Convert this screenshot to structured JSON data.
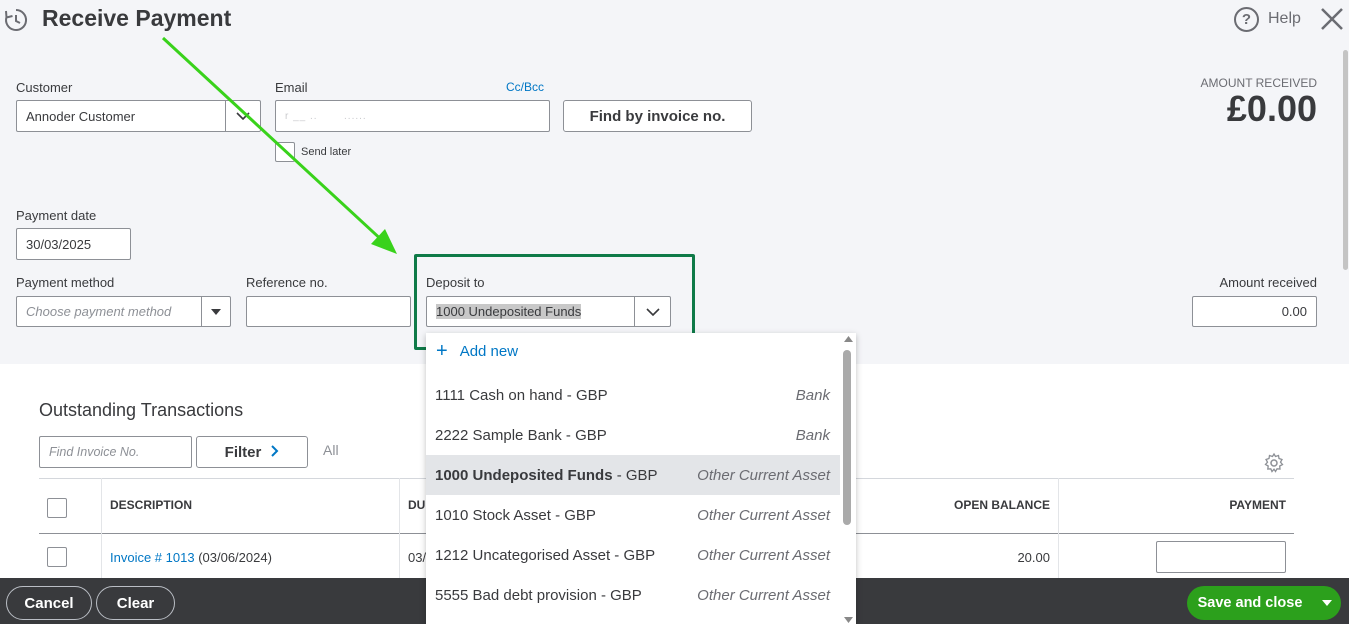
{
  "header": {
    "title": "Receive Payment",
    "help_label": "Help"
  },
  "customer": {
    "label": "Customer",
    "value": "Annoder Customer"
  },
  "email": {
    "label": "Email",
    "cc_bcc": "Cc/Bcc",
    "value": "r __ ..       ......",
    "send_later": "Send later"
  },
  "find_invoice_button": "Find by invoice no.",
  "amount_received_header": {
    "label": "AMOUNT RECEIVED",
    "value": "£0.00"
  },
  "payment_date": {
    "label": "Payment date",
    "value": "30/03/2025"
  },
  "payment_method": {
    "label": "Payment method",
    "placeholder": "Choose payment method"
  },
  "reference": {
    "label": "Reference no.",
    "value": ""
  },
  "deposit_to": {
    "label": "Deposit to",
    "value": "1000 Undeposited Funds"
  },
  "amount_received_field": {
    "label": "Amount received",
    "value": "0.00"
  },
  "deposit_dropdown": {
    "add_new": "Add new",
    "items": [
      {
        "name": "1111 Cash on hand",
        "currency": " - GBP",
        "type": "Bank",
        "selected": false
      },
      {
        "name": "2222 Sample Bank",
        "currency": " - GBP",
        "type": "Bank",
        "selected": false
      },
      {
        "name": "1000 Undeposited Funds",
        "currency": " - GBP",
        "type": "Other Current Asset",
        "selected": true
      },
      {
        "name": "1010 Stock Asset",
        "currency": " - GBP",
        "type": "Other Current Asset",
        "selected": false
      },
      {
        "name": "1212 Uncategorised Asset",
        "currency": " - GBP",
        "type": "Other Current Asset",
        "selected": false
      },
      {
        "name": "5555 Bad debt provision",
        "currency": " - GBP",
        "type": "Other Current Asset",
        "selected": false
      }
    ]
  },
  "outstanding": {
    "title": "Outstanding Transactions",
    "search_placeholder": "Find Invoice No.",
    "filter_label": "Filter",
    "all_label": "All",
    "columns": {
      "description": "DESCRIPTION",
      "due": "DU",
      "open_balance": "OPEN BALANCE",
      "payment": "PAYMENT"
    },
    "rows": [
      {
        "invoice_link": "Invoice # 1013",
        "date": " (03/06/2024)",
        "due": "03/",
        "open_balance": "20.00",
        "payment": ""
      }
    ]
  },
  "footer": {
    "cancel": "Cancel",
    "clear": "Clear",
    "save_close": "Save and close"
  },
  "colors": {
    "accent_green": "#2ca01c",
    "link_blue": "#0077c5",
    "highlight_box": "#0f7a48",
    "annotation_arrow": "#39d21b",
    "footer_bg": "#393a3d"
  }
}
